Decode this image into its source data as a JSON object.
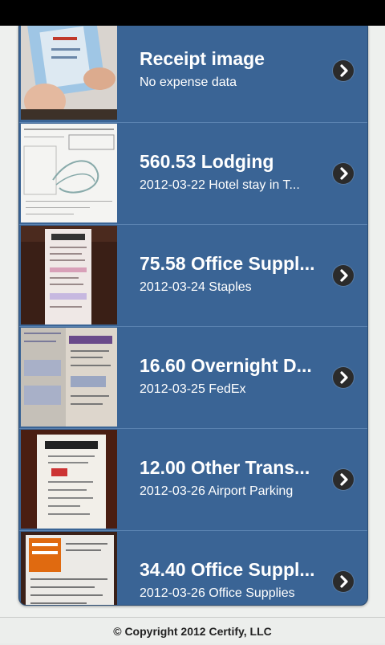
{
  "receipts": [
    {
      "title": "Receipt image",
      "subtitle": "No expense data",
      "thumb": "receipt-held-in-hand"
    },
    {
      "title": "560.53 Lodging",
      "subtitle": "2012-03-22 Hotel stay in T...",
      "thumb": "hotel-folio"
    },
    {
      "title": "75.58 Office Suppl...",
      "subtitle": "2012-03-24 Staples",
      "thumb": "staples-receipt"
    },
    {
      "title": "16.60 Overnight D...",
      "subtitle": "2012-03-25 FedEx",
      "thumb": "fedex-receipt"
    },
    {
      "title": "12.00 Other Trans...",
      "subtitle": "2012-03-26 Airport Parking",
      "thumb": "parking-receipt"
    },
    {
      "title": "34.40 Office Suppl...",
      "subtitle": "2012-03-26 Office Supplies",
      "thumb": "home-depot-receipt"
    }
  ],
  "footer": {
    "copyright": "© Copyright 2012 Certify, LLC"
  },
  "colors": {
    "list_bg": "#3a6495",
    "chevron": "#2b2b2b",
    "footer_bg": "#eceeec"
  },
  "icons": {
    "row_action": "chevron-right-icon"
  }
}
